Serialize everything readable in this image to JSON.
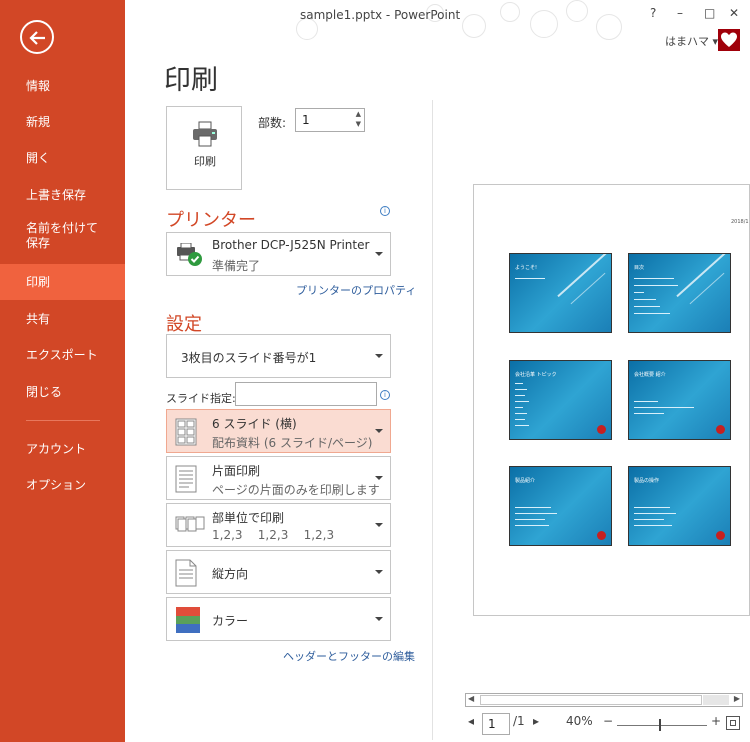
{
  "window": {
    "title": "sample1.pptx - PowerPoint",
    "help": "?",
    "minimize": "–",
    "restore": "□",
    "close": "✕",
    "user": "はまハマ ▾"
  },
  "sidebar": {
    "items": [
      {
        "label": "情報"
      },
      {
        "label": "新規"
      },
      {
        "label": "開く"
      },
      {
        "label": "上書き保存"
      },
      {
        "label": "名前を付けて\n保存"
      },
      {
        "label": "印刷"
      },
      {
        "label": "共有"
      },
      {
        "label": "エクスポート"
      },
      {
        "label": "閉じる"
      },
      {
        "label": "アカウント"
      },
      {
        "label": "オプション"
      }
    ],
    "active": "印刷",
    "accent": "#d24726",
    "active_bg": "#f0623e"
  },
  "main": {
    "title": "印刷",
    "print_button": "印刷",
    "copies_label": "部数:",
    "copies_value": "1",
    "printer_heading": "プリンター",
    "printer_name": "Brother DCP-J525N Printer",
    "printer_status": "準備完了",
    "printer_properties_link": "プリンターのプロパティ",
    "settings_heading": "設定",
    "range_option": "3枚目のスライド番号が1",
    "slides_label": "スライド指定:",
    "slides_value": "",
    "layout_option": {
      "main": "6 スライド (横)",
      "sub": "配布資料 (6 スライド/ページ)"
    },
    "sides_option": {
      "main": "片面印刷",
      "sub": "ページの片面のみを印刷します"
    },
    "collate_option": {
      "main": "部単位で印刷",
      "sub": "1,2,3    1,2,3    1,2,3"
    },
    "orientation_option": "縦方向",
    "color_option": "カラー",
    "header_footer_link": "ヘッダーとフッターの編集"
  },
  "preview": {
    "page_date": "2018/1",
    "thumbnails": [
      {
        "title": "ようこそ!",
        "badge": false
      },
      {
        "title": "目次",
        "badge": false
      },
      {
        "title": "会社沿革 トピック",
        "badge": true
      },
      {
        "title": "会社概要 紹介",
        "badge": true
      },
      {
        "title": "製品紹介",
        "badge": true
      },
      {
        "title": "製品の操作",
        "badge": true
      }
    ],
    "page_current": "1",
    "page_total": "/1",
    "zoom": "40%"
  },
  "icons": [
    "back-arrow-icon",
    "printer-icon",
    "info-icon",
    "printer-ready-icon",
    "layout-grid-icon",
    "single-side-icon",
    "collate-icon",
    "portrait-icon",
    "color-icon",
    "zoom-fit-icon"
  ]
}
